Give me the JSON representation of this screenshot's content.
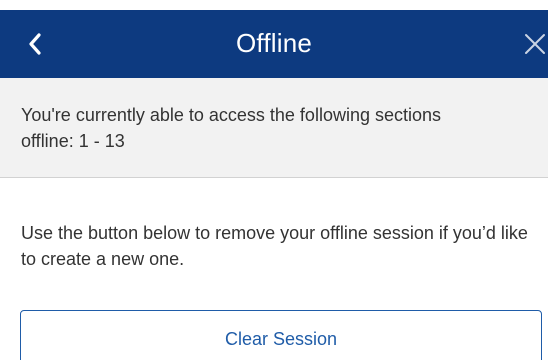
{
  "header": {
    "title": "Offline",
    "back_icon": "chevron-left-icon",
    "close_icon": "close-icon",
    "background_color": "#0d3a80"
  },
  "info_banner": {
    "text": "You're currently able to access the following sections offline: 1 - 13"
  },
  "instruction": {
    "text": "Use the button below to remove your offline session if you’d like to create a new one."
  },
  "actions": {
    "clear_session_label": "Clear Session",
    "accent_color": "#1f5ca8"
  }
}
